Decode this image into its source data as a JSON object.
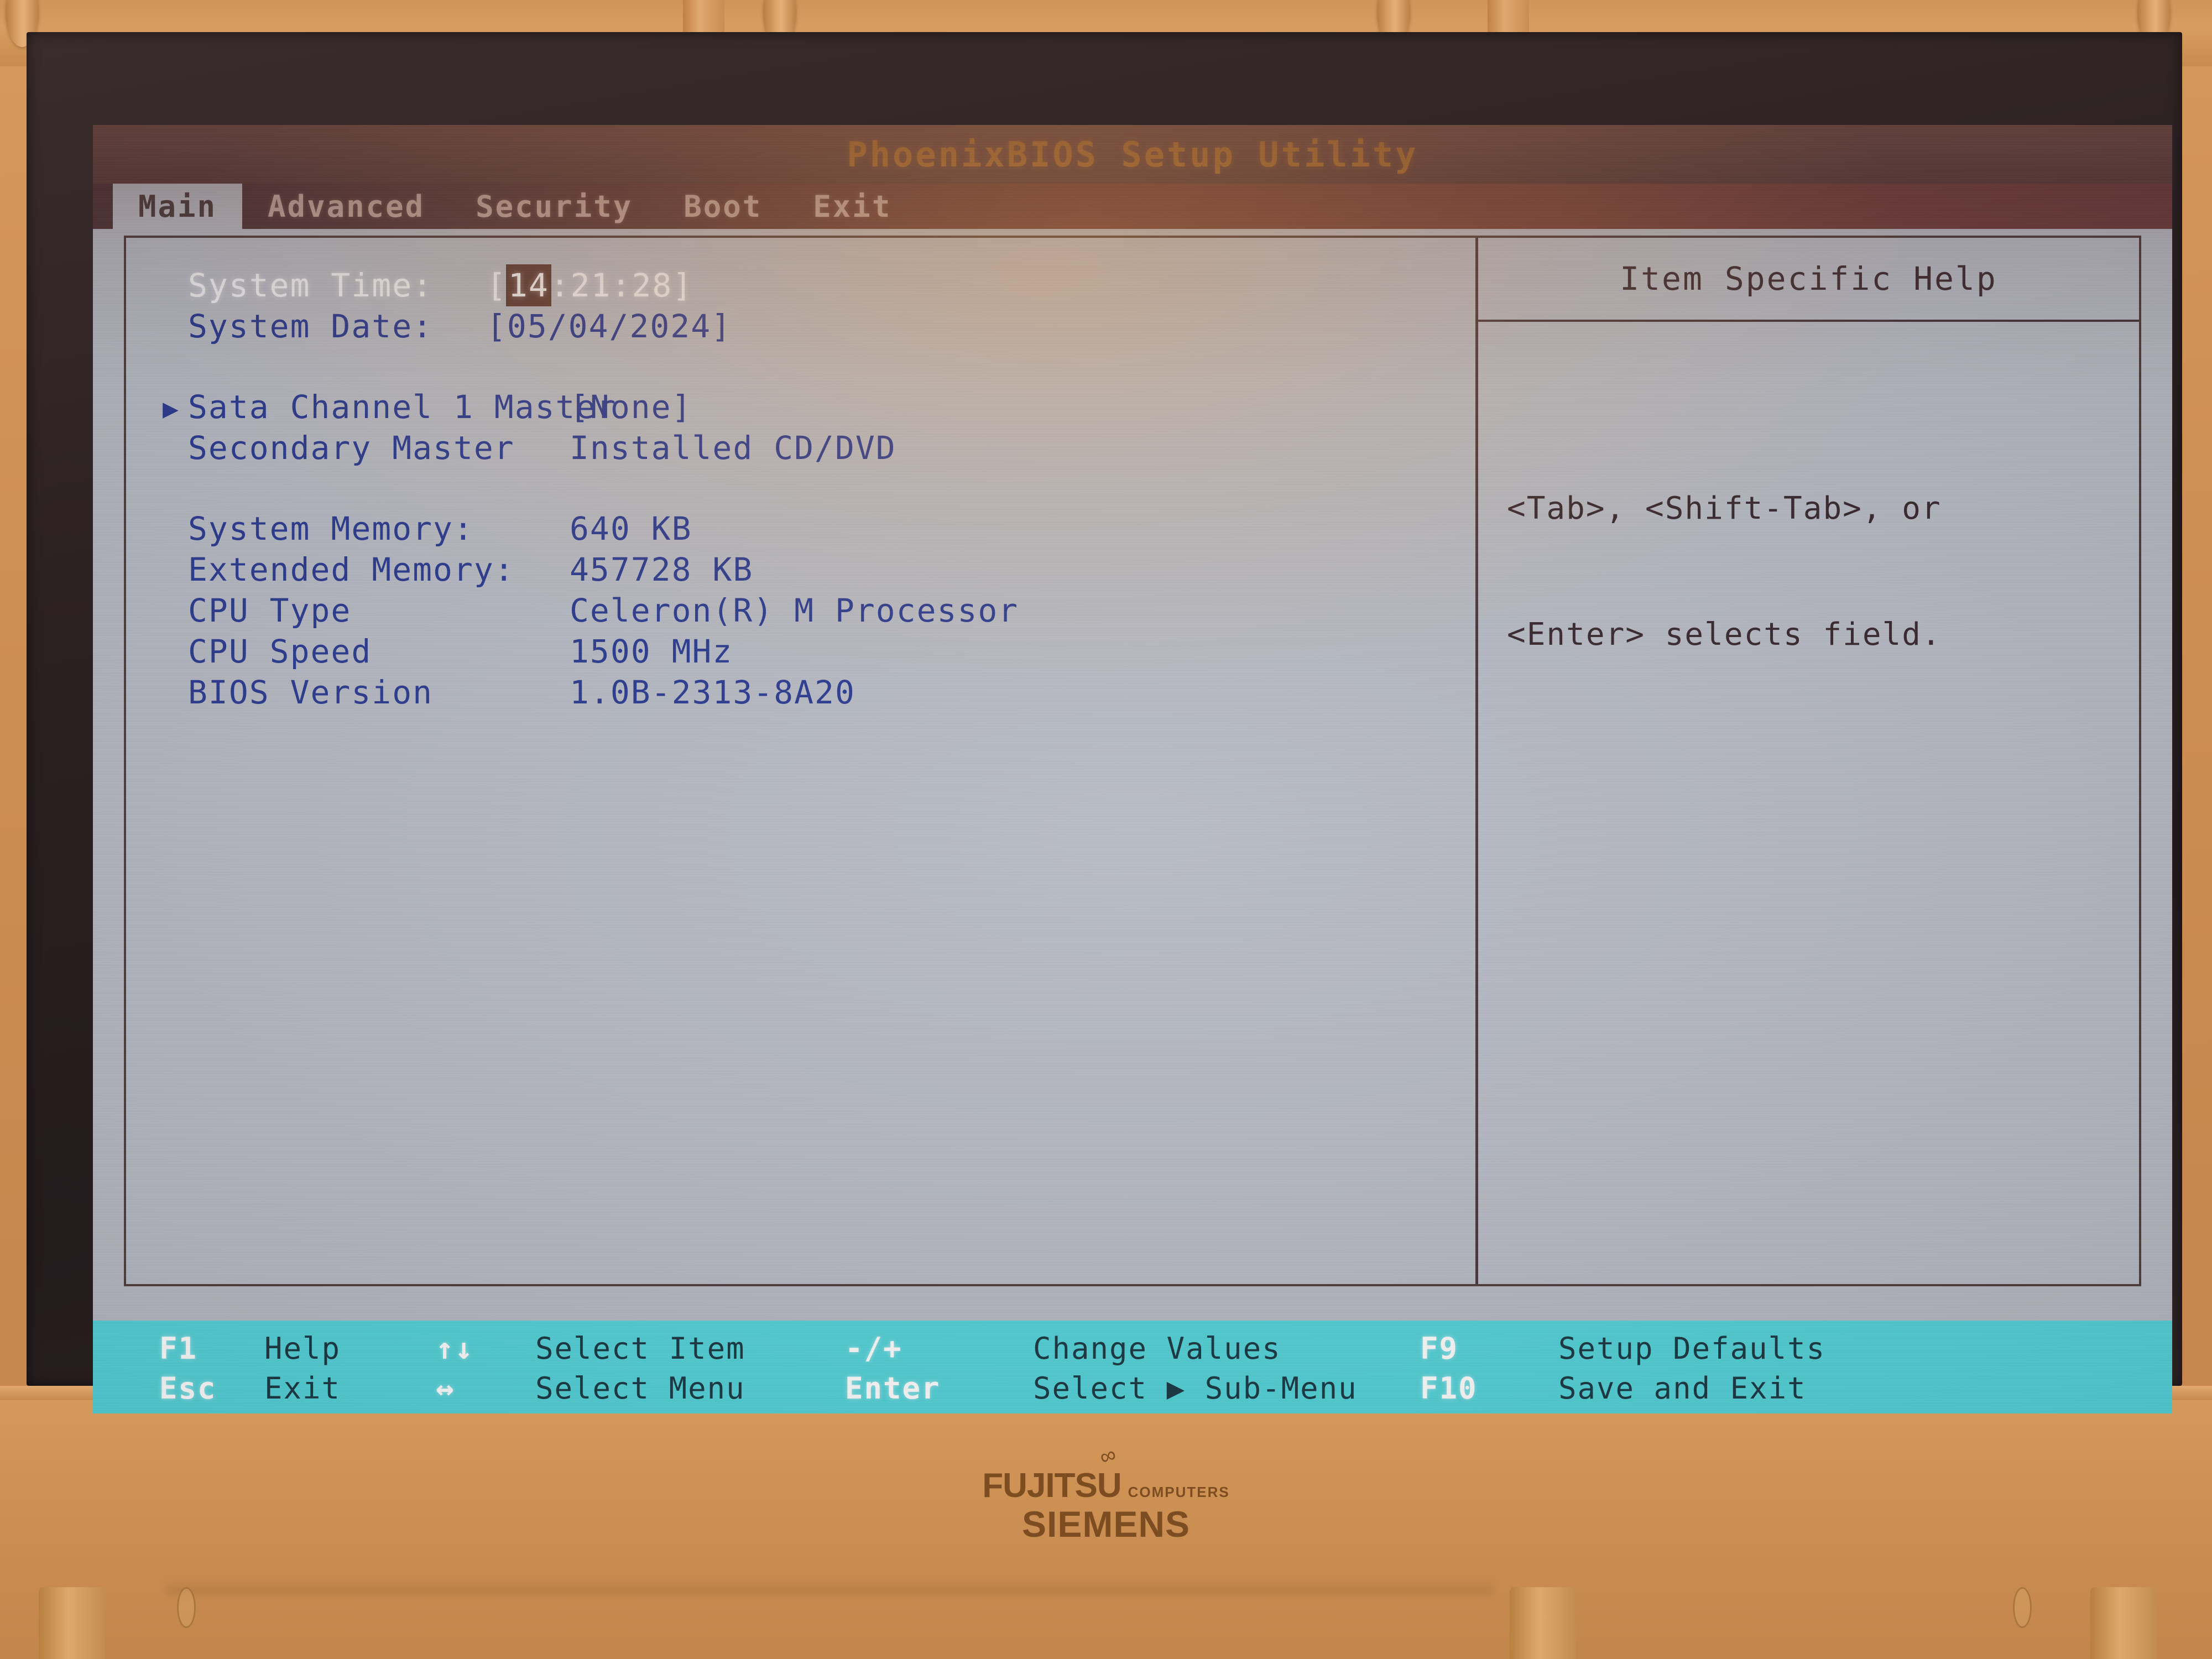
{
  "window": {
    "title": "PhoenixBIOS Setup Utility"
  },
  "tabs": [
    {
      "label": "Main",
      "active": true
    },
    {
      "label": "Advanced",
      "active": false
    },
    {
      "label": "Security",
      "active": false
    },
    {
      "label": "Boot",
      "active": false
    },
    {
      "label": "Exit",
      "active": false
    }
  ],
  "main": {
    "rows": [
      {
        "label": "System Time:",
        "value": "[14:21:28]",
        "selected": true,
        "cursor": "14"
      },
      {
        "label": "System Date:",
        "value": "[05/04/2024]",
        "selected": false
      },
      {
        "label": "Sata Channel 1 Master",
        "value": "[None]",
        "submenu": true
      },
      {
        "label": "Secondary Master",
        "value": "Installed CD/DVD"
      },
      {
        "label": "System Memory:",
        "value": "640 KB"
      },
      {
        "label": "Extended Memory:",
        "value": "457728 KB"
      },
      {
        "label": "CPU Type",
        "value": "Celeron(R) M Processor"
      },
      {
        "label": "CPU Speed",
        "value": "1500 MHz"
      },
      {
        "label": "BIOS Version",
        "value": "1.0B-2313-8A20"
      }
    ],
    "time_bracket_open": "[",
    "time_cursor": "14",
    "time_rest": ":21:28]",
    "submenu_arrow": "▶"
  },
  "help": {
    "title": "Item Specific Help",
    "line1": "<Tab>, <Shift-Tab>, or",
    "line2": "<Enter> selects field."
  },
  "footer": {
    "row1": {
      "key1": "F1",
      "desc1": "Help",
      "key2": "↑↓",
      "desc2": "Select Item",
      "key3": "-/+",
      "desc3": "Change Values",
      "key4": "F9",
      "desc4": "Setup Defaults"
    },
    "row2": {
      "key1": "Esc",
      "desc1": "Exit",
      "key2": "↔",
      "desc2": "Select Menu",
      "key3": "Enter",
      "desc3": "Select ▶ Sub-Menu",
      "key4": "F10",
      "desc4": "Save and Exit"
    }
  },
  "chassis": {
    "brand": "FUJITSU",
    "brand_sub": "COMPUTERS",
    "brand_second": "SIEMENS",
    "infinity": "∞"
  },
  "colors": {
    "bios_bg": "#b5b9c2",
    "bios_text": "#26378f",
    "title_text": "#a96f2e",
    "footer_bg": "#4fd2d8",
    "footer_key": "#ffffff",
    "footer_desc": "#14343f",
    "chassis": "#cf9054"
  }
}
